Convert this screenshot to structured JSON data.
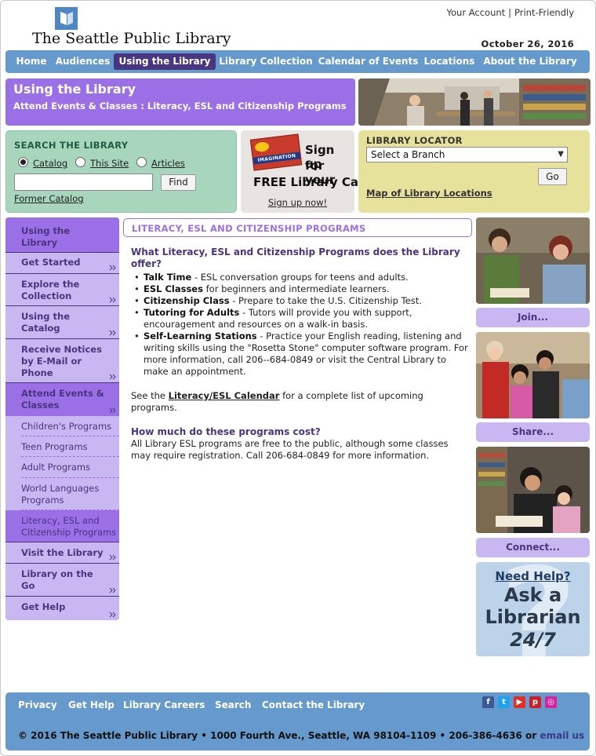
{
  "header": {
    "logo_text": "The Seattle Public Library",
    "your_account": "Your Account",
    "print_friendly": "Print-Friendly",
    "separator": "|",
    "date": "October 26, 2016"
  },
  "nav": {
    "items": [
      {
        "label": "Home"
      },
      {
        "label": "Audiences"
      },
      {
        "label": "Using the Library",
        "active": true
      },
      {
        "label": "Library Collection"
      },
      {
        "label": "Calendar of Events"
      },
      {
        "label": "Locations"
      },
      {
        "label": "About the Library"
      }
    ]
  },
  "banner": {
    "title": "Using the Library",
    "subtitle": "Attend Events & Classes : Literacy, ESL and Citizenship Programs"
  },
  "search": {
    "heading": "SEARCH THE LIBRARY",
    "options": [
      "Catalog",
      "This Site",
      "Articles"
    ],
    "selected": "Catalog",
    "input_value": "",
    "find_button": "Find",
    "former_catalog": "Former Catalog"
  },
  "signup": {
    "card_text": "IMAGINATION",
    "line1": "Sign up",
    "line2": "for your",
    "line3": "FREE Library Card!",
    "link": "Sign up now!"
  },
  "locator": {
    "heading": "LIBRARY LOCATOR",
    "select_value": "Select a Branch",
    "go_button": "Go",
    "map_link": "Map of Library Locations"
  },
  "sidebar": {
    "items": [
      {
        "label": "Using the Library",
        "kind": "top"
      },
      {
        "label": "Get Started"
      },
      {
        "label": "Explore the Collection"
      },
      {
        "label": "Using the Catalog"
      },
      {
        "label": "Receive Notices by E-Mail or Phone"
      },
      {
        "label": "Attend Events & Classes",
        "selected": true
      },
      {
        "label": "Children's Programs",
        "kind": "sub"
      },
      {
        "label": "Teen Programs",
        "kind": "sub"
      },
      {
        "label": "Adult Programs",
        "kind": "sub"
      },
      {
        "label": "World Languages Programs",
        "kind": "sub"
      },
      {
        "label": "Literacy, ESL and Citizenship Programs",
        "kind": "sub",
        "selected": true
      },
      {
        "label": "Visit the Library"
      },
      {
        "label": "Library on the Go"
      },
      {
        "label": "Get Help"
      }
    ]
  },
  "main": {
    "heading": "LITERACY, ESL AND CITIZENSHIP PROGRAMS",
    "q1": "What Literacy, ESL and Citizenship Programs does the Library offer?",
    "bullets": [
      {
        "term": "Talk Time",
        "text": " - ESL conversation groups for teens and adults."
      },
      {
        "term": "ESL Classes",
        "text": " for beginners and intermediate learners."
      },
      {
        "term": "Citizenship Class",
        "text": " - Prepare to take the U.S. Citizenship Test."
      },
      {
        "term": "Tutoring for Adults",
        "text": " - Tutors will provide you with support, encouragement and resources on a walk-in basis."
      },
      {
        "term": "Self-Learning Stations",
        "text": " - Practice your English reading, listening and writing skills using the \"Rosetta Stone\" computer software program. For more information, call 206--684-0849 or visit the Central Library to make an appointment."
      }
    ],
    "see_prefix": "See the ",
    "calendar_link": "Literacy/ESL Calendar",
    "see_suffix": " for a complete list of upcoming programs.",
    "q2": "How much do these programs cost?",
    "cost_text": "All Library ESL programs are free to the public, although some classes may require registration. Call 206-684-0849 for more information."
  },
  "right": {
    "buttons": [
      "Join...",
      "Share...",
      "Connect..."
    ],
    "ask": {
      "line1": "Need Help?",
      "line2": "Ask a",
      "line3": "Librarian",
      "line4": "24/7"
    }
  },
  "footer": {
    "links": [
      "Privacy",
      "Get Help",
      "Library Careers",
      "Search",
      "Contact the Library"
    ],
    "social": [
      {
        "icon": "facebook-icon",
        "glyph": "f",
        "color": "#3b5998"
      },
      {
        "icon": "twitter-icon",
        "glyph": "t",
        "color": "#1da1f2"
      },
      {
        "icon": "youtube-icon",
        "glyph": "▶",
        "color": "#e52d27"
      },
      {
        "icon": "pinterest-icon",
        "glyph": "p",
        "color": "#cb2027"
      },
      {
        "icon": "instagram-icon",
        "glyph": "◎",
        "color": "#d6249f"
      }
    ],
    "copyright": "© 2016 The Seattle Public Library • 1000 Fourth Ave., Seattle, WA 98104-1109 • 206-386-4636 or ",
    "email_link": "email us"
  },
  "colors": {
    "nav_blue": "#6699cc",
    "purple": "#9b6fe6",
    "dark_purple": "#4a3580",
    "light_purple": "#c9b7f1",
    "green_panel": "#a7d6bc",
    "yellow_panel": "#e6e19b"
  }
}
